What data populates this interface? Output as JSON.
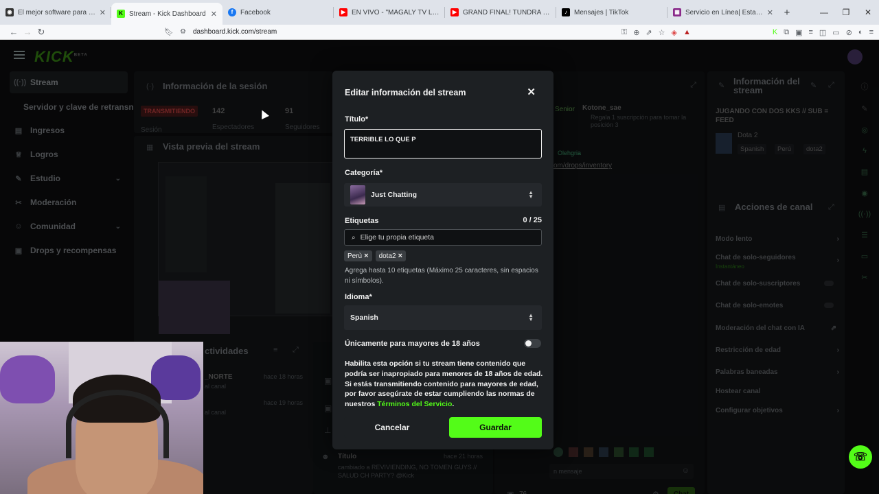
{
  "browser": {
    "tabs": [
      {
        "title": "El mejor software para potenciar tu",
        "favicon": "browser-icon",
        "color": "#333333"
      },
      {
        "title": "Stream - Kick Dashboard",
        "favicon": "kick-icon",
        "color": "#53fc18"
      },
      {
        "title": "Facebook",
        "favicon": "facebook-icon",
        "color": "#1877f2"
      },
      {
        "title": "EN VIVO - \"MAGALY TV LA FI",
        "favicon": "youtube-icon",
        "color": "#ff0000"
      },
      {
        "title": "GRAND FINAL! TUNDRA vs YANDEX",
        "favicon": "youtube-icon",
        "color": "#ff0000"
      },
      {
        "title": "Mensajes | TikTok",
        "favicon": "tiktok-icon",
        "color": "#000000"
      },
      {
        "title": "Servicio en Línea| Estado de Trámite",
        "favicon": "gov-icon",
        "color": "#8a2a8a"
      }
    ],
    "url": "dashboard.kick.com/stream"
  },
  "sidebar": {
    "items": [
      {
        "label": "Stream",
        "icon": "broadcast-icon"
      },
      {
        "label": "Servidor y clave de retransn",
        "icon": ""
      },
      {
        "label": "Ingresos",
        "icon": "income-icon"
      },
      {
        "label": "Logros",
        "icon": "trophy-icon"
      },
      {
        "label": "Estudio",
        "icon": "studio-icon"
      },
      {
        "label": "Moderación",
        "icon": "wrench-icon"
      },
      {
        "label": "Comunidad",
        "icon": "community-icon"
      },
      {
        "label": "Drops y recompensas",
        "icon": "gift-icon"
      }
    ]
  },
  "background": {
    "session_title": "Información de la sesión",
    "status_badge": "TRANSMITIENDO",
    "viewers_count": "142",
    "viewers_label": "Espectadores",
    "followers_count": "91",
    "followers_label": "Seguidores",
    "session_label": "Sesión",
    "preview_title": "Vista previa del stream",
    "activity_title": "ctividades",
    "activity_user": "_NORTE",
    "activity_time1": "hace 18 horas",
    "activity_time2": "hace 19 horas",
    "activity_sub1": "al canal",
    "activity_sub2": "al canal",
    "title_event": "Título",
    "title_event_time": "hace 21 horas",
    "title_event_text": "cambiado a REVIVIENDING, NO TOMEN GUYS // SALUD CH PARTY? @Kick",
    "chat_senior": "Senior",
    "chat_user": "Kotone_sae",
    "chat_gift_line": "Regala 1 suscripción para tomar la posición 3",
    "chat_pinned_user": "Olehgria",
    "chat_link": "om/drops/inventory",
    "chat_count": "76",
    "chat_button": "Chat",
    "chat_placeholder": "n mensaje",
    "stream_info_title": "Información del stream",
    "stream_info_text": "JUGANDO CON DOS KKS // SUB = FEED",
    "stream_game": "Dota 2",
    "stream_tags": [
      "Spanish",
      "Perú",
      "dota2"
    ],
    "channel_actions_title": "Acciones de canal",
    "channel_actions": [
      {
        "label": "Modo lento",
        "type": "chevron"
      },
      {
        "label": "Chat de solo-seguidores",
        "sub": "Instantáneo",
        "type": "chevron"
      },
      {
        "label": "Chat de solo-suscriptores",
        "type": "toggle"
      },
      {
        "label": "Chat de solo-emotes",
        "type": "toggle"
      },
      {
        "label": "Moderación del chat con IA",
        "type": "ext"
      },
      {
        "label": "Restricción de edad",
        "type": "chevron"
      },
      {
        "label": "Palabras baneadas",
        "type": "chevron"
      },
      {
        "label": "Hostear canal",
        "type": "none"
      },
      {
        "label": "Configurar objetivos",
        "type": "chevron"
      }
    ]
  },
  "modal": {
    "title": "Editar información del stream",
    "title_label": "Título*",
    "title_value": "TERRIBLE LO QUE P",
    "category_label": "Categoría*",
    "category_value": "Just Chatting",
    "tags_label": "Etiquetas",
    "tags_count": "0 / 25",
    "tags_placeholder": "Elige tu propia etiqueta",
    "tags": [
      "Perù",
      "dota2"
    ],
    "tags_hint": "Agrega hasta 10 etiquetas (Máximo 25 caracteres, sin espacios ni símbolos).",
    "language_label": "Idioma*",
    "language_value": "Spanish",
    "adult_label": "Únicamente para mayores de 18 años",
    "adult_enabled": false,
    "adult_desc": "Habilita esta opción si tu stream tiene contenido que podría ser inapropiado para menores de 18 años de edad. Si estás transmitiendo contenido para mayores de edad, por favor asegúrate de estar cumpliendo las normas de nuestros ",
    "adult_link": "Términos del Servicio",
    "adult_desc_end": ".",
    "cancel_label": "Cancelar",
    "save_label": "Guardar"
  },
  "colors": {
    "accent": "#53fc18",
    "modal_bg": "#1d2023",
    "page_bg": "#0d0e10"
  }
}
